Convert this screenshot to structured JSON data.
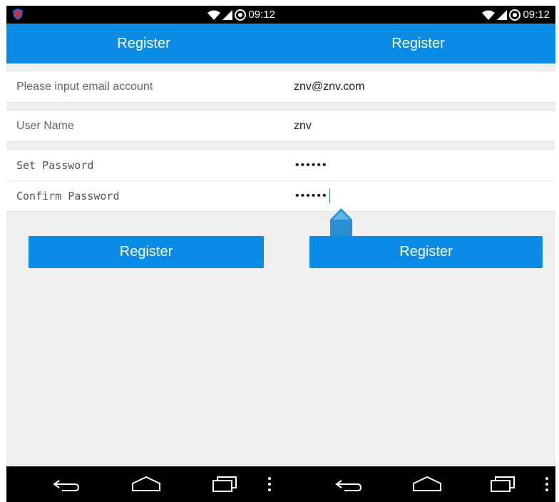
{
  "status": {
    "time": "09:12"
  },
  "colors": {
    "accent": "#0a8ce6",
    "background": "#efefef",
    "bar": "#000000"
  },
  "left": {
    "title": "Register",
    "email_placeholder": "Please input email account",
    "username_placeholder": "User Name",
    "password_placeholder": "Set Password",
    "confirm_placeholder": "Confirm Password",
    "register_label": "Register"
  },
  "right": {
    "title": "Register",
    "email_value": "znv@znv.com",
    "username_value": "znv",
    "password_value": "••••••",
    "confirm_value": "••••••",
    "register_label": "Register"
  },
  "icons": {
    "shield": "shield-icon",
    "wifi": "wifi-icon",
    "signal": "signal-icon",
    "badge": "notification-badge-icon",
    "back": "back-icon",
    "home": "home-icon",
    "recent": "recent-apps-icon",
    "menu": "overflow-menu-icon",
    "handle": "text-selection-handle-icon"
  }
}
